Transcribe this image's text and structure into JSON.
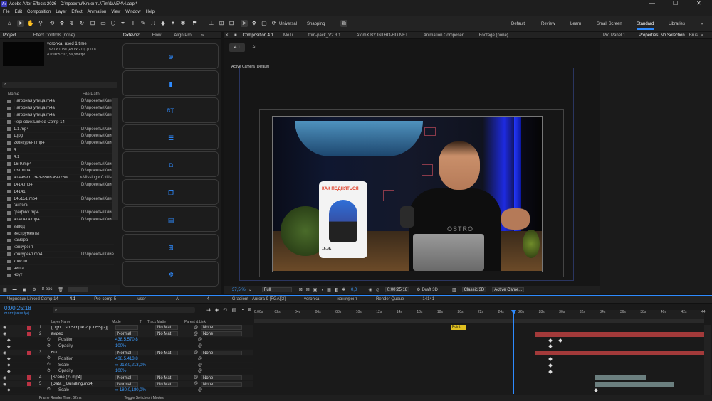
{
  "app": {
    "title": "Adobe After Effects 2026 - D:\\проекты\\Клиенты\\Tim\\1\\AE\\4\\4.aep *",
    "logo": "Ae",
    "minimize": "—",
    "maximize": "☐",
    "close": "✕"
  },
  "menu": [
    "File",
    "Edit",
    "Composition",
    "Layer",
    "Effect",
    "Animation",
    "View",
    "Window",
    "Help"
  ],
  "toolbar": {
    "universal": "Universal",
    "snapping": "Snapping",
    "workspaces": [
      "Default",
      "Review",
      "Learn",
      "Small Screen",
      "Standard",
      "Libraries"
    ],
    "active_workspace": "Standard",
    "more": "»"
  },
  "project": {
    "tabs": [
      "Project",
      "Effect Controls (none)"
    ],
    "comp_name": "voronka",
    "used": ", used 1 time",
    "size": "1920 x 1080 (480 x 270) (1,00)",
    "duration": "Δ 0:00:57:07, 59,989 fps",
    "search_placeholder": "⌕",
    "col_name": "Name",
    "col_path": "File Path",
    "bpc": "8 bpc",
    "items": [
      {
        "n": "Нагорная улица.m4a",
        "p": "D:\\проекты\\Клие"
      },
      {
        "n": "Нагорная улица.m4a",
        "p": "D:\\проекты\\Клие"
      },
      {
        "n": "Нагорная улица.m4a",
        "p": "D:\\проекты\\Клие"
      },
      {
        "n": "Черновик Linked Comp 14",
        "p": ""
      },
      {
        "n": "1.1.mp4",
        "p": "D:\\проекты\\Клие"
      },
      {
        "n": "1.jpg",
        "p": "D:\\проекты\\Клие"
      },
      {
        "n": "2конкурент.mp4",
        "p": "D:\\проекты\\Клие"
      },
      {
        "n": "4",
        "p": ""
      },
      {
        "n": "4.1",
        "p": ""
      },
      {
        "n": "16-9.mp4",
        "p": "D:\\проекты\\Клие"
      },
      {
        "n": "131.mp4",
        "p": "D:\\проекты\\Клие"
      },
      {
        "n": "414a89d...3e3-65e6364f26ee.png",
        "p": "<Missing>:C:\\Use"
      },
      {
        "n": "1414.mp4",
        "p": "D:\\проекты\\Клие"
      },
      {
        "n": "14141",
        "p": ""
      },
      {
        "n": "145151.mp4",
        "p": "D:\\проекты\\Клие"
      },
      {
        "n": "гантели",
        "p": ""
      },
      {
        "n": "графикк.mp4",
        "p": "D:\\проекты\\Клие"
      },
      {
        "n": "4141414.mp4",
        "p": "D:\\проекты\\Клие"
      },
      {
        "n": "завод",
        "p": ""
      },
      {
        "n": "инструменты",
        "p": ""
      },
      {
        "n": "камера",
        "p": ""
      },
      {
        "n": "конкурент",
        "p": ""
      },
      {
        "n": "конкурент.mp4",
        "p": "D:\\проекты\\Клие"
      },
      {
        "n": "кресло",
        "p": ""
      },
      {
        "n": "ниша",
        "p": ""
      },
      {
        "n": "ноут",
        "p": ""
      }
    ]
  },
  "textevo": {
    "tabs": [
      "textevo2",
      "Flow",
      "Align Pro"
    ],
    "more": "»",
    "icons": [
      "plus-circle-icon",
      "trash-icon",
      "text-icon",
      "lines-icon",
      "layers-icon",
      "copy-icon",
      "duplicate-icon",
      "grid-plus-icon",
      "gear-icon"
    ],
    "glyphs": [
      "⊕",
      "▮",
      "ᴿT",
      "☰",
      "⧉",
      "❐",
      "▤",
      "⊞",
      "✲"
    ]
  },
  "viewer": {
    "tabs": [
      "Composition 4.1",
      "MoTi",
      "trim-pack_V2.3.1",
      "AtomX BY INTRO-HD.NET",
      "Animation Composer",
      "Footage (none)"
    ],
    "subtabs": [
      "4.1",
      "AI"
    ],
    "camera": "Active Camera (Default)",
    "zoom": "37,5 %",
    "quality": "Full",
    "exposure": "+0,0",
    "timecode": "0:00:25:18",
    "draft": "Draft 3D",
    "renderer": "Classic 3D",
    "view": "Active Came...",
    "card_title": "КАК ПОДНЯТЬСЯ",
    "card_count": "16.3K",
    "shirt": "OSTRO"
  },
  "right": {
    "tabs": [
      "Pro Panel 1",
      "Properties: No Selection",
      "Brus"
    ],
    "more": "»"
  },
  "timeline": {
    "tabs": [
      "Черновик Linked Comp 14",
      "4.1",
      "Pre-comp 5",
      "user",
      "AI",
      "4",
      "Gradient - Aurora 9 [FGA][2]",
      "voronka",
      "конкурент",
      "Render Queue",
      "14141"
    ],
    "active_tab": "4.1",
    "timecode": "0:00:25:18",
    "frames": "01517 (59,99 fps)",
    "search_placeholder": "⌕",
    "cols": {
      "layer": "Layer Name",
      "mode": "Mode",
      "t": "T",
      "matte": "Track Matte",
      "parent": "Parent & Link"
    },
    "ticks": [
      "0:00s",
      "02s",
      "04s",
      "06s",
      "08s",
      "10s",
      "12s",
      "14s",
      "16s",
      "18s",
      "20s",
      "22s",
      "24s",
      "26s",
      "28s",
      "30s",
      "32s",
      "34s",
      "36s",
      "38s",
      "40s",
      "42s",
      "44"
    ],
    "marker": "Point",
    "rows": [
      {
        "k": "layer",
        "num": "1",
        "name": "[Light...sh Simple 2 [CLFS][2]]",
        "mode": "",
        "matte": "No Mat",
        "parent": "None"
      },
      {
        "k": "layer",
        "num": "2",
        "name": "видео",
        "mode": "Normal",
        "matte": "No Mat",
        "parent": "None"
      },
      {
        "k": "prop",
        "name": "Position",
        "val": "438,5,570,8"
      },
      {
        "k": "prop",
        "name": "Opacity",
        "val": "100%"
      },
      {
        "k": "layer",
        "num": "3",
        "name": "600",
        "mode": "Normal",
        "matte": "No Mat",
        "parent": "None"
      },
      {
        "k": "prop",
        "name": "Position",
        "val": "438,5,413,8"
      },
      {
        "k": "prop",
        "name": "Scale",
        "val": "∞ 213,0,213,0%"
      },
      {
        "k": "prop",
        "name": "Opacity",
        "val": "100%"
      },
      {
        "k": "layer",
        "num": "4",
        "name": "[Scene (2).mp4]",
        "mode": "Normal",
        "matte": "No Mat",
        "parent": "None"
      },
      {
        "k": "layer",
        "num": "5",
        "name": "[Data _ Bundling.mp4]",
        "mode": "Normal",
        "matte": "No Mat",
        "parent": "None"
      },
      {
        "k": "prop",
        "name": "Scale",
        "val": "∞ 180,0,180,0%"
      }
    ],
    "footer_left": "Frame Render Time: 62ms",
    "footer_right": "Toggle Switches / Modes"
  },
  "colors": {
    "accent": "#2e8bff",
    "timeline_bar": "#a33a3a",
    "bg": "#141414"
  }
}
